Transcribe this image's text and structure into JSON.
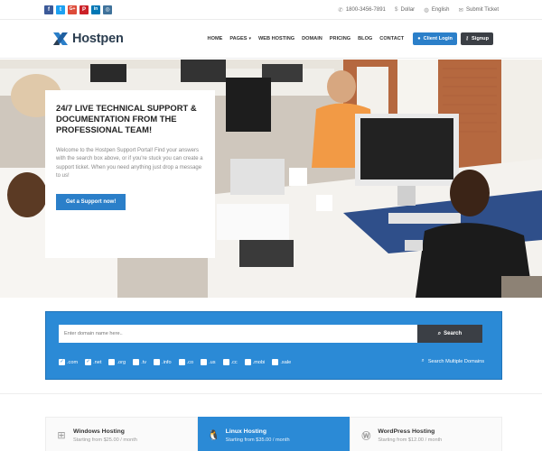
{
  "topbar": {
    "social": [
      {
        "icon": "facebook-icon",
        "glyph": "f",
        "color": "#3b5998"
      },
      {
        "icon": "twitter-icon",
        "glyph": "t",
        "color": "#1da1f2"
      },
      {
        "icon": "google-plus-icon",
        "glyph": "G+",
        "color": "#dd4b39"
      },
      {
        "icon": "pinterest-icon",
        "glyph": "P",
        "color": "#cb2027"
      },
      {
        "icon": "linkedin-icon",
        "glyph": "in",
        "color": "#0077b5"
      },
      {
        "icon": "instagram-icon",
        "glyph": "◎",
        "color": "#3f729b"
      }
    ],
    "phone": "1800-3456-7891",
    "currency": "Dollar",
    "language": "English",
    "submit_ticket": "Submit Ticket"
  },
  "header": {
    "logo_text": "Hostpen",
    "nav": [
      "HOME",
      "PAGES",
      "WEB HOSTING",
      "DOMAIN",
      "PRICING",
      "BLOG",
      "CONTACT"
    ],
    "client_login": "Client Login",
    "signup": "Signup"
  },
  "hero": {
    "title": "24/7 LIVE TECHNICAL SUPPORT & DOCUMENTATION FROM THE PROFESSIONAL TEAM!",
    "text": "Welcome to the Hostpen Support Portal! Find your answers with the search box above, or if you're stuck you can create a support ticket. When you need anything just drop a message to us!",
    "button": "Get a Support now!"
  },
  "domain_search": {
    "placeholder": "Enter domain name here..",
    "search_label": "Search",
    "tlds": [
      {
        "label": ".com",
        "checked": true
      },
      {
        "label": ".net",
        "checked": true
      },
      {
        "label": ".org",
        "checked": false
      },
      {
        "label": ".tv",
        "checked": false
      },
      {
        "label": ".info",
        "checked": false
      },
      {
        "label": ".co",
        "checked": false
      },
      {
        "label": ".us",
        "checked": false
      },
      {
        "label": ".cc",
        "checked": false
      },
      {
        "label": ".mobi",
        "checked": false
      },
      {
        "label": ".sale",
        "checked": false
      }
    ],
    "multi_label": "Search Multiple Domains"
  },
  "hosting": [
    {
      "name": "Windows Hosting",
      "price": "Starting from $25.00 / month",
      "icon": "windows-icon",
      "active": false
    },
    {
      "name": "Linux Hosting",
      "price": "Starting from $35.00 / month",
      "icon": "linux-icon",
      "active": true
    },
    {
      "name": "WordPress Hosting",
      "price": "Starting from $12.00 / month",
      "icon": "wordpress-icon",
      "active": false
    }
  ],
  "colors": {
    "accent": "#2b8ad6",
    "dark": "#3b3f45",
    "brand_text": "#2c3e50"
  }
}
